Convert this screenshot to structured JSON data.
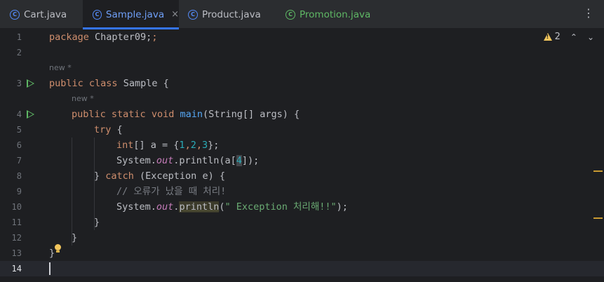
{
  "tabs": [
    {
      "label": "Cart.java",
      "icon": "class-icon",
      "active": false
    },
    {
      "label": "Sample.java",
      "icon": "class-icon",
      "active": true
    },
    {
      "label": "Product.java",
      "icon": "class-icon",
      "active": false
    },
    {
      "label": "Promotion.java",
      "icon": "main-class-icon",
      "active": false
    }
  ],
  "tab_more_label": "⋮",
  "tab_close_label": "×",
  "inspection": {
    "warning_count": "2",
    "up_label": "⌃",
    "down_label": "⌄"
  },
  "hints": {
    "class_hint": "new *",
    "method_hint": "new *"
  },
  "line_numbers": [
    "1",
    "2",
    "3",
    "4",
    "5",
    "6",
    "7",
    "8",
    "9",
    "10",
    "11",
    "12",
    "13",
    "14"
  ],
  "code": {
    "l1": [
      "package",
      " Chapter09;"
    ],
    "l3": [
      "public",
      " ",
      "class",
      " Sample {"
    ],
    "l4": [
      "public",
      " ",
      "static",
      " ",
      "void",
      " ",
      "main",
      "(String[] args) {"
    ],
    "l5": [
      "try",
      " {"
    ],
    "l6": [
      "int",
      "[] a = {",
      "1",
      ",",
      "2",
      ",",
      "3",
      "};"
    ],
    "l7": [
      "System.",
      "out",
      ".println(a[",
      "4",
      "]);"
    ],
    "l8": [
      "} ",
      "catch",
      " (Exception e) {"
    ],
    "l9": [
      "// 오류가 났을 때 처리!"
    ],
    "l10": [
      "System.",
      "out",
      ".",
      "println",
      "(",
      "\" Exception 처리해!!\"",
      ");"
    ],
    "l11": [
      "}"
    ],
    "l12": [
      "}"
    ],
    "l13": [
      "}"
    ]
  },
  "colors": {
    "background": "#1e1f22",
    "tabbar": "#2b2d30",
    "accent": "#3574f0",
    "keyword": "#cf8e6d",
    "string": "#6aab73",
    "number": "#2aacb8"
  }
}
